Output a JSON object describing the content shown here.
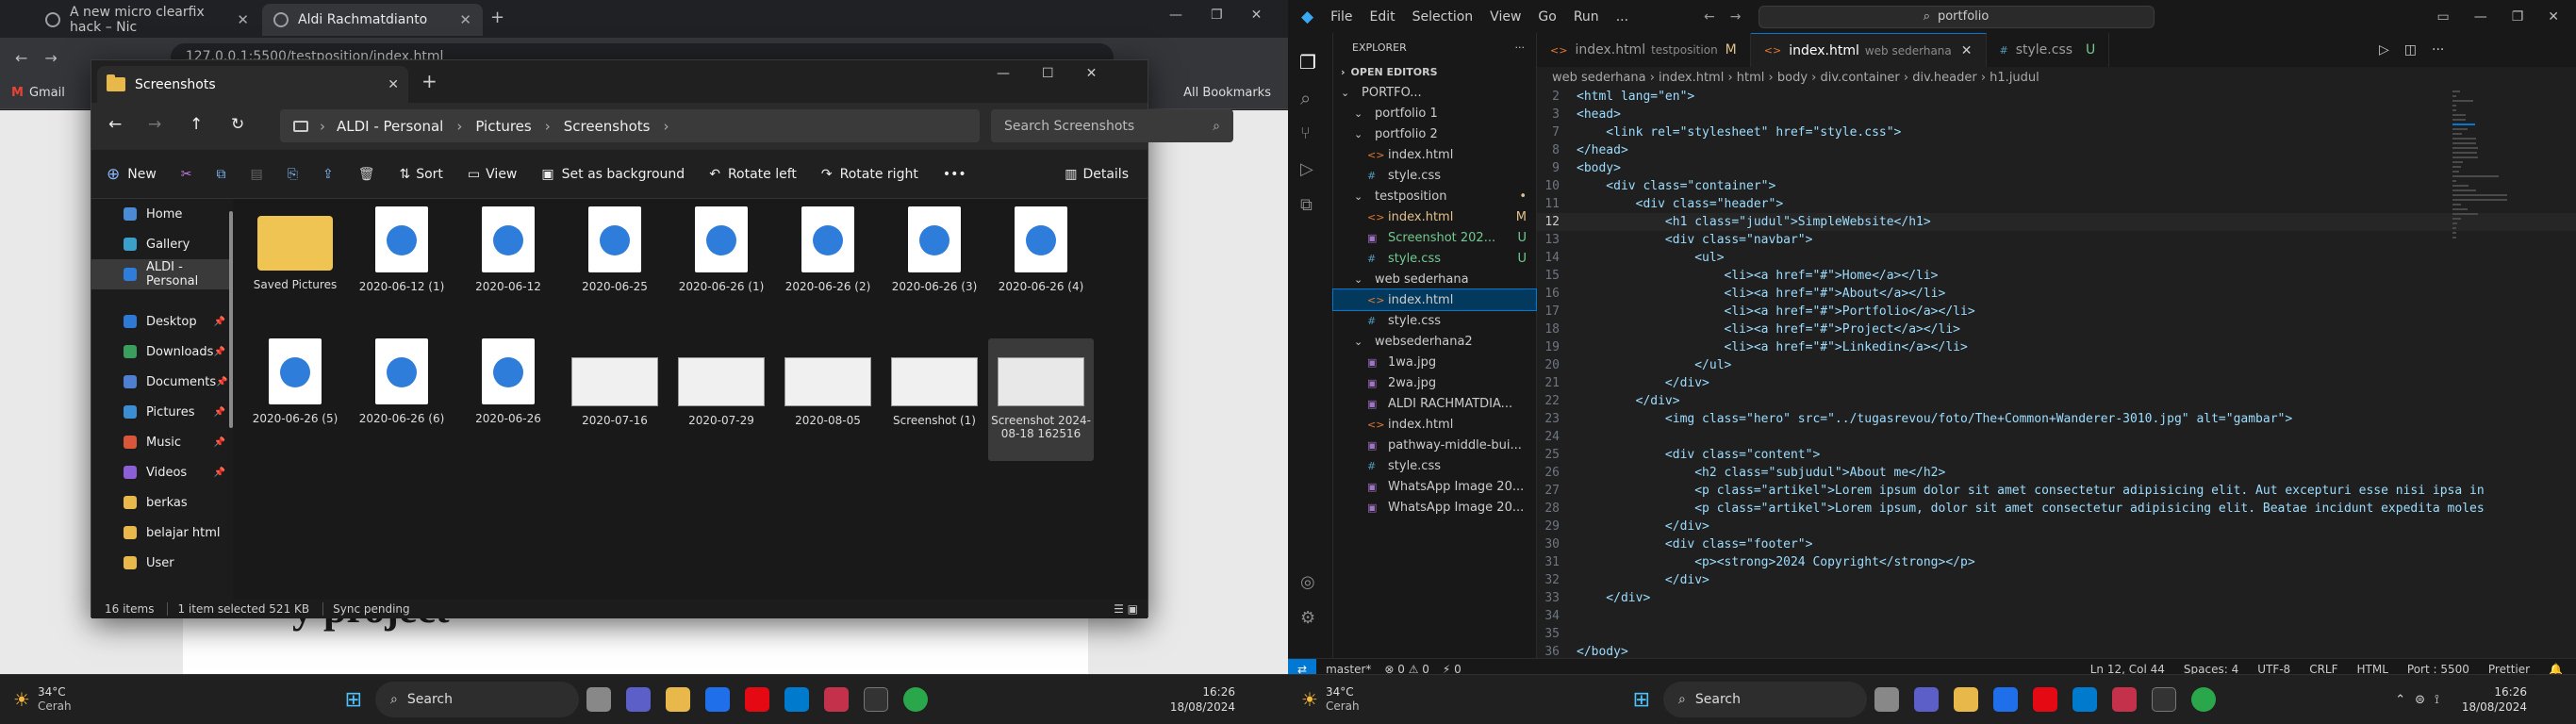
{
  "left": {
    "browser": {
      "tabs": [
        {
          "label": "A new micro clearfix hack – Nic"
        },
        {
          "label": "Aldi Rachmatdianto"
        }
      ],
      "url": "127.0.0.1:5500/testposition/index.html",
      "bookmarks": [
        "Gmail"
      ],
      "all_bookmarks": "All Bookmarks"
    },
    "explorer": {
      "tab_title": "Screenshots",
      "breadcrumb": [
        "ALDI - Personal",
        "Pictures",
        "Screenshots"
      ],
      "search_placeholder": "Search Screenshots",
      "commands": {
        "new": "New",
        "sort": "Sort",
        "view": "View",
        "set_background": "Set as background",
        "rotate_left": "Rotate left",
        "rotate_right": "Rotate right",
        "details": "Details"
      },
      "sidebar": [
        {
          "label": "Home",
          "color": "#4b8bd6"
        },
        {
          "label": "Gallery",
          "color": "#3aa0c9"
        },
        {
          "label": "ALDI - Personal",
          "color": "#2f7ddb"
        },
        {
          "label": "Desktop",
          "color": "#2d79d4"
        },
        {
          "label": "Downloads",
          "color": "#3a9e5c"
        },
        {
          "label": "Documents",
          "color": "#4f7fd0"
        },
        {
          "label": "Pictures",
          "color": "#3a8ed1"
        },
        {
          "label": "Music",
          "color": "#d8563a"
        },
        {
          "label": "Videos",
          "color": "#8b5fd6"
        },
        {
          "label": "berkas",
          "color": "#e9b84a"
        },
        {
          "label": "belajar html",
          "color": "#e9b84a"
        },
        {
          "label": "User",
          "color": "#e9b84a"
        }
      ],
      "files": [
        {
          "name": "Saved Pictures",
          "kind": "folder"
        },
        {
          "name": "2020-06-12 (1)",
          "kind": "image"
        },
        {
          "name": "2020-06-12",
          "kind": "image"
        },
        {
          "name": "2020-06-25",
          "kind": "image"
        },
        {
          "name": "2020-06-26 (1)",
          "kind": "image"
        },
        {
          "name": "2020-06-26 (2)",
          "kind": "image"
        },
        {
          "name": "2020-06-26 (3)",
          "kind": "image"
        },
        {
          "name": "2020-06-26 (4)",
          "kind": "image"
        },
        {
          "name": "2020-06-26 (5)",
          "kind": "image"
        },
        {
          "name": "2020-06-26 (6)",
          "kind": "image"
        },
        {
          "name": "2020-06-26",
          "kind": "image"
        },
        {
          "name": "2020-07-16",
          "kind": "shot"
        },
        {
          "name": "2020-07-29",
          "kind": "shot"
        },
        {
          "name": "2020-08-05",
          "kind": "shot"
        },
        {
          "name": "Screenshot (1)",
          "kind": "shot"
        },
        {
          "name": "Screenshot 2024-08-18 162516",
          "kind": "shot",
          "selected": true
        }
      ],
      "status": {
        "items": "16 items",
        "selected": "1 item selected  521 KB",
        "sync": "Sync pending"
      }
    },
    "page_text": "y project",
    "taskbar": {
      "weather_temp": "34°C",
      "weather_desc": "Cerah",
      "search": "Search",
      "time": "16:26",
      "date": "18/08/2024"
    }
  },
  "right": {
    "vscode": {
      "menu": [
        "File",
        "Edit",
        "Selection",
        "View",
        "Go",
        "Run",
        "..."
      ],
      "command_center": "portfolio",
      "explorer_title": "EXPLORER",
      "open_editors": "OPEN EDITORS",
      "tree": [
        {
          "label": "PORTFO...",
          "level": 0,
          "type": "folder"
        },
        {
          "label": "portfolio 1",
          "level": 1,
          "type": "folder"
        },
        {
          "label": "portfolio 2",
          "level": 1,
          "type": "folder"
        },
        {
          "label": "index.html",
          "level": 2,
          "type": "html"
        },
        {
          "label": "style.css",
          "level": 2,
          "type": "css"
        },
        {
          "label": "testposition",
          "level": 1,
          "type": "folder",
          "mark": "•"
        },
        {
          "label": "index.html",
          "level": 2,
          "type": "html",
          "mark": "M"
        },
        {
          "label": "Screenshot 202...",
          "level": 2,
          "type": "img",
          "mark": "U"
        },
        {
          "label": "style.css",
          "level": 2,
          "type": "css",
          "mark": "U"
        },
        {
          "label": "web sederhana",
          "level": 1,
          "type": "folder"
        },
        {
          "label": "index.html",
          "level": 2,
          "type": "html",
          "selected": true
        },
        {
          "label": "style.css",
          "level": 2,
          "type": "css"
        },
        {
          "label": "websederhana2",
          "level": 1,
          "type": "folder"
        },
        {
          "label": "1wa.jpg",
          "level": 2,
          "type": "img"
        },
        {
          "label": "2wa.jpg",
          "level": 2,
          "type": "img"
        },
        {
          "label": "ALDI RACHMATDIA...",
          "level": 2,
          "type": "img"
        },
        {
          "label": "index.html",
          "level": 2,
          "type": "html"
        },
        {
          "label": "pathway-middle-bui...",
          "level": 2,
          "type": "img"
        },
        {
          "label": "style.css",
          "level": 2,
          "type": "css"
        },
        {
          "label": "WhatsApp Image 20...",
          "level": 2,
          "type": "img"
        },
        {
          "label": "WhatsApp Image 20...",
          "level": 2,
          "type": "img"
        }
      ],
      "tabs": [
        {
          "label": "index.html",
          "desc": "testposition",
          "mark": "M"
        },
        {
          "label": "index.html",
          "desc": "web sederhana",
          "active": true
        },
        {
          "label": "style.css",
          "desc": "",
          "mark": "U"
        }
      ],
      "breadcrumb": "web sederhana  ›  index.html  ›  html  ›  body  ›  div.container  ›  div.header  ›  h1.judul",
      "code_lines": [
        {
          "n": "2",
          "t": "<html lang=\"en\">"
        },
        {
          "n": "3",
          "t": "<head>"
        },
        {
          "n": "7",
          "t": "    <link rel=\"stylesheet\" href=\"style.css\">"
        },
        {
          "n": "8",
          "t": "</head>"
        },
        {
          "n": "9",
          "t": "<body>"
        },
        {
          "n": "10",
          "t": "    <div class=\"container\">"
        },
        {
          "n": "11",
          "t": "        <div class=\"header\">"
        },
        {
          "n": "12",
          "t": "            <h1 class=\"judul\">SimpleWebsite</h1>",
          "cur": true
        },
        {
          "n": "13",
          "t": "            <div class=\"navbar\">"
        },
        {
          "n": "14",
          "t": "                <ul>"
        },
        {
          "n": "15",
          "t": "                    <li><a href=\"#\">Home</a></li>"
        },
        {
          "n": "16",
          "t": "                    <li><a href=\"#\">About</a></li>"
        },
        {
          "n": "17",
          "t": "                    <li><a href=\"#\">Portfolio</a></li>"
        },
        {
          "n": "18",
          "t": "                    <li><a href=\"#\">Project</a></li>"
        },
        {
          "n": "19",
          "t": "                    <li><a href=\"#\">Linkedin</a></li>"
        },
        {
          "n": "20",
          "t": "                </ul>"
        },
        {
          "n": "21",
          "t": "            </div>"
        },
        {
          "n": "22",
          "t": "        </div>"
        },
        {
          "n": "23",
          "t": "            <img class=\"hero\" src=\"../tugasrevou/foto/The+Common+Wanderer-3010.jpg\" alt=\"gambar\">"
        },
        {
          "n": "24",
          "t": ""
        },
        {
          "n": "25",
          "t": "            <div class=\"content\">"
        },
        {
          "n": "26",
          "t": "                <h2 class=\"subjudul\">About me</h2>"
        },
        {
          "n": "27",
          "t": "                <p class=\"artikel\">Lorem ipsum dolor sit amet consectetur adipisicing elit. Aut excepturi esse nisi ipsa in"
        },
        {
          "n": "28",
          "t": "                <p class=\"artikel\">Lorem ipsum, dolor sit amet consectetur adipisicing elit. Beatae incidunt expedita moles"
        },
        {
          "n": "29",
          "t": "            </div>"
        },
        {
          "n": "30",
          "t": "            <div class=\"footer\">"
        },
        {
          "n": "31",
          "t": "                <p><strong>2024 Copyright</strong></p>"
        },
        {
          "n": "32",
          "t": "            </div>"
        },
        {
          "n": "33",
          "t": "    </div>"
        },
        {
          "n": "34",
          "t": ""
        },
        {
          "n": "35",
          "t": ""
        },
        {
          "n": "36",
          "t": "</body>"
        }
      ],
      "status": {
        "branch": "master*",
        "errors": "⊗ 0 ⚠ 0",
        "ports": "⚡ 0",
        "position": "Ln 12, Col 44",
        "spaces": "Spaces: 4",
        "encoding": "UTF-8",
        "eol": "CRLF",
        "language": "HTML",
        "port": "Port : 5500",
        "prettier": "Prettier"
      }
    },
    "taskbar": {
      "weather_temp": "34°C",
      "weather_desc": "Cerah",
      "search": "Search",
      "time": "16:26",
      "date": "18/08/2024"
    }
  },
  "colors": {
    "accent": "#0078d4",
    "html_icon": "#e37933",
    "css_icon": "#519aba",
    "img_icon": "#a074c4",
    "modified": "#e2c08d",
    "untracked": "#73c991"
  }
}
